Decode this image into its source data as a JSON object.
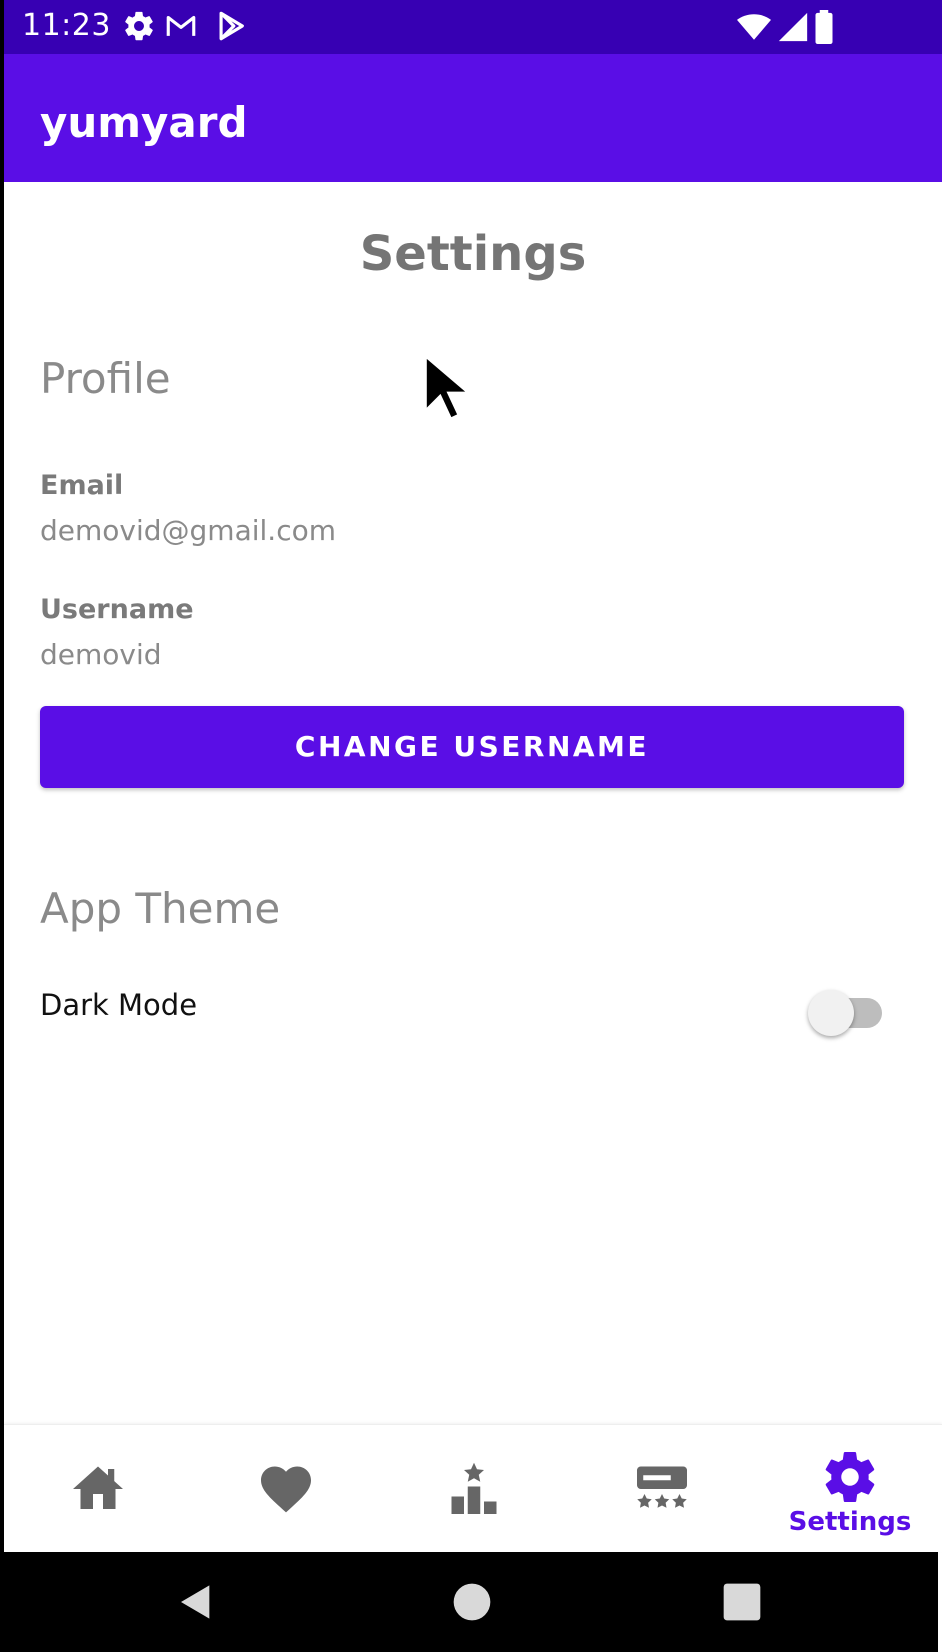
{
  "status_bar": {
    "time": "11:23",
    "left_icons": [
      "gear-icon",
      "gmail-icon",
      "play-store-icon"
    ],
    "right_icons": [
      "wifi-icon",
      "signal-icon",
      "battery-icon"
    ]
  },
  "app_bar": {
    "title": "yumyard"
  },
  "page": {
    "title": "Settings"
  },
  "profile": {
    "section_title": "Profile",
    "email_label": "Email",
    "email_value": "demovid@gmail.com",
    "username_label": "Username",
    "username_value": "demovid",
    "change_username_label": "CHANGE USERNAME"
  },
  "theme": {
    "section_title": "App Theme",
    "dark_mode_label": "Dark Mode",
    "dark_mode_on": false
  },
  "bottom_nav": {
    "items": [
      {
        "icon": "home-icon",
        "label": "",
        "active": false
      },
      {
        "icon": "heart-icon",
        "label": "",
        "active": false
      },
      {
        "icon": "leaderboard-icon",
        "label": "",
        "active": false
      },
      {
        "icon": "reviews-icon",
        "label": "",
        "active": false
      },
      {
        "icon": "settings-icon",
        "label": "Settings",
        "active": true
      }
    ]
  },
  "colors": {
    "status_bar": "#3700b3",
    "primary": "#5a0ee6",
    "inactive_icon": "#666666"
  }
}
